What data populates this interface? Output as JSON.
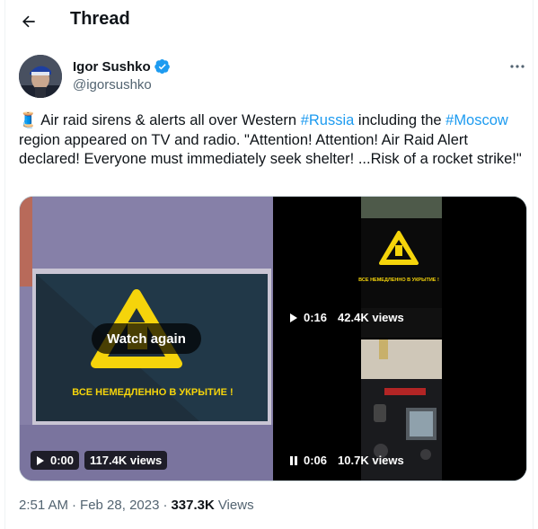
{
  "header": {
    "title": "Thread"
  },
  "author": {
    "name": "Igor Sushko",
    "handle": "@igorsushko"
  },
  "tweet": {
    "emoji": "🧵",
    "text_1": " Air raid sirens & alerts all over Western ",
    "hashtag_1": "#Russia",
    "text_2": " including the ",
    "hashtag_2": "#Moscow",
    "text_3": " region appeared on TV and radio. \"Attention!  Attention! Air Raid Alert declared! Everyone must immediately seek shelter! ...Risk of a rocket strike!\""
  },
  "media": {
    "videos": [
      {
        "id": "big",
        "sign_text": "ВСЕ НЕМЕДЛЕННО В УКРЫТИЕ !",
        "overlay": "Watch again",
        "time": "0:00",
        "views": "117.4K views",
        "state": "play"
      },
      {
        "id": "tr",
        "sign_text": "ВСЕ НЕМЕДЛЕННО В УКРЫТИЕ !",
        "time": "0:16",
        "views": "42.4K views",
        "state": "play"
      },
      {
        "id": "br",
        "time": "0:06",
        "views": "10.7K views",
        "state": "pause"
      }
    ]
  },
  "meta": {
    "time": "2:51 AM",
    "date": "Feb 28, 2023",
    "views_count": "337.3K",
    "views_label": "Views"
  },
  "colors": {
    "accent": "#1d9bf0",
    "secondary": "#536471",
    "warning": "#f5d40b"
  }
}
